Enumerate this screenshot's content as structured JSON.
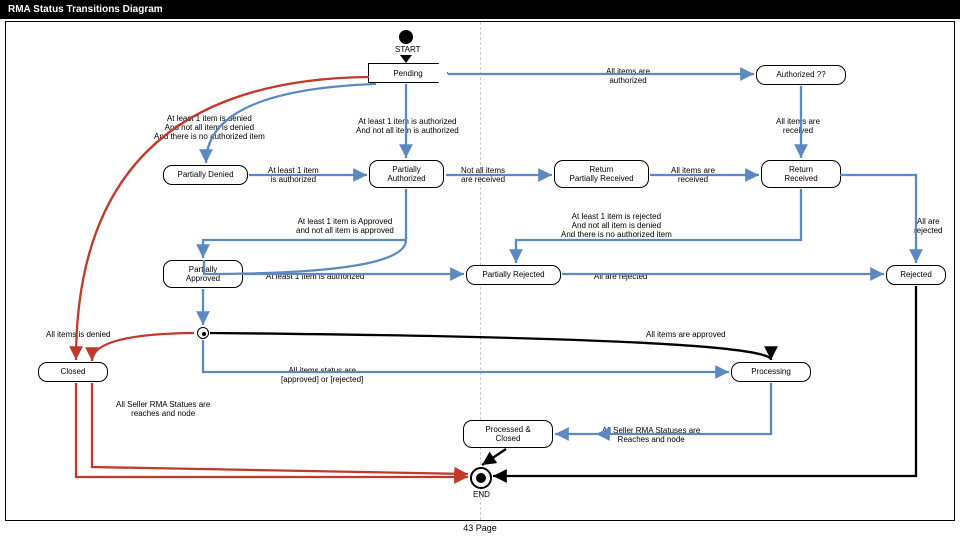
{
  "header": {
    "title": "RMA Status Transitions Diagram"
  },
  "footer": {
    "page": "43 Page"
  },
  "labels": {
    "start": "START",
    "end": "END",
    "items_denied_all": "All items is denied",
    "items_approved_all": "All items are approved",
    "items_authorized_all": "All items are\nauthorized",
    "items_received_all": "All items are\nreceived",
    "not_all_received": "Not all items\nare received",
    "received_all": "All items are\nreceived",
    "all_rejected": "All are rejected",
    "all_are_rejected": "All are\nrejected",
    "pd_cond": "At least 1 item is denied\nAnd not all item is denied\nAnd there is no authorized item",
    "pa_cond": "At least 1 item is authorized\nAnd not all item is authorized",
    "pd_to_pa": "At least 1 item\nis authorized",
    "pr_cond": "At least 1 item is rejected\nAnd not all item is denied\nAnd there is no authorized item",
    "approved_cond": "At least 1 item is Approved\nand not all item is approved",
    "pa_auth": "At least 1 item is authorized",
    "proc_status": "All items status are\n[approved] or [rejected]",
    "seller_end": "All Seller RMA Statues are\nreaches and node",
    "seller_end2": "All Seller RMA Statuses are\nReaches and node"
  },
  "nodes": {
    "pending": "Pending",
    "authorized": "Authorized ??",
    "partially_denied": "Partially Denied",
    "partially_authorized": "Partially\nAuthorized",
    "return_partial": "Return\nPartially Received",
    "return_received": "Return\nReceived",
    "partially_approved": "Partially\nApproved",
    "partially_rejected": "Partially Rejected",
    "rejected": "Rejected",
    "closed": "Closed",
    "processing": "Processing",
    "processed_closed": "Processed &\nClosed"
  },
  "colors": {
    "blue": "#5b89c0",
    "red": "#c0392b",
    "black": "#000"
  }
}
